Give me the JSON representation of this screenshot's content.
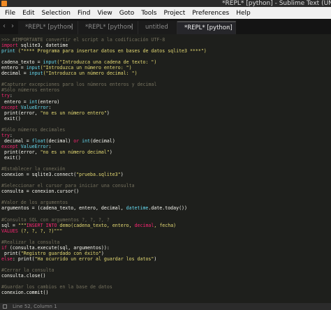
{
  "window": {
    "title": "*REPL* [python] - Sublime Text (UNREG"
  },
  "menu": [
    "File",
    "Edit",
    "Selection",
    "Find",
    "View",
    "Goto",
    "Tools",
    "Project",
    "Preferences",
    "Help"
  ],
  "tabs": [
    {
      "label": "*REPL* [python]",
      "active": false
    },
    {
      "label": "*REPL* [python]",
      "active": false
    },
    {
      "label": "untitled",
      "active": false
    },
    {
      "label": "*REPL* [python]",
      "active": true
    }
  ],
  "code": [
    [
      [
        ">>> ",
        "c"
      ],
      [
        "#IMPORTANTE convertir el script a la codificación UTF-8",
        "c"
      ]
    ],
    [
      [
        "import ",
        "k"
      ],
      [
        "sqlite3, datetime",
        ""
      ]
    ],
    [
      [
        "print ",
        "f"
      ],
      [
        "(\"**** Programa para insertar datos en bases de datos sqlite3 ****\")",
        "s"
      ]
    ],
    [],
    [
      [
        "cadena_texto = ",
        ""
      ],
      [
        "input",
        "f"
      ],
      [
        "(\"Introduzca una cadena de texto: \")",
        "s"
      ]
    ],
    [
      [
        "entero = ",
        ""
      ],
      [
        "input",
        "f"
      ],
      [
        "(\"Introduzca un número entero: \")",
        "s"
      ]
    ],
    [
      [
        "decimal = ",
        ""
      ],
      [
        "input",
        "f"
      ],
      [
        "(\"Introduzca un número decimal: \")",
        "s"
      ]
    ],
    [],
    [
      [
        "#Capturar excepciones para los números enteros y decimal",
        "c"
      ]
    ],
    [
      [
        "#Sólo números enteros",
        "c"
      ]
    ],
    [
      [
        "try",
        "k"
      ],
      [
        ":",
        ""
      ]
    ],
    [
      [
        " entero = ",
        ""
      ],
      [
        "int",
        "f"
      ],
      [
        "(entero)",
        ""
      ]
    ],
    [
      [
        "except ",
        "k"
      ],
      [
        "ValueError",
        "f"
      ],
      [
        ":",
        ""
      ]
    ],
    [
      [
        " print(error, ",
        ""
      ],
      [
        "\"no es un número entero\"",
        "s"
      ],
      [
        ")",
        ""
      ]
    ],
    [
      [
        " exit()",
        ""
      ]
    ],
    [],
    [
      [
        "#Sólo números decimales",
        "c"
      ]
    ],
    [
      [
        "try",
        "k"
      ],
      [
        ":",
        ""
      ]
    ],
    [
      [
        " decimal = ",
        ""
      ],
      [
        "float",
        "f"
      ],
      [
        "(decimal) ",
        ""
      ],
      [
        "or ",
        "k"
      ],
      [
        "int",
        "f"
      ],
      [
        "(decimal)",
        ""
      ]
    ],
    [
      [
        "except ",
        "k"
      ],
      [
        "ValueError",
        "f"
      ],
      [
        ":",
        ""
      ]
    ],
    [
      [
        " print(error, ",
        ""
      ],
      [
        "\"no es un número decimal\"",
        "s"
      ],
      [
        ")",
        ""
      ]
    ],
    [
      [
        " exit()",
        ""
      ]
    ],
    [],
    [
      [
        "#Establecer la conexión",
        "c"
      ]
    ],
    [
      [
        "conexion = sqlite3.connect(",
        ""
      ],
      [
        "\"prueba.sqlite3\"",
        "s"
      ],
      [
        ")",
        ""
      ]
    ],
    [],
    [
      [
        "#Seleccionar el cursor para iniciar una consulta",
        "c"
      ]
    ],
    [
      [
        "consulta = conexion.cursor()",
        ""
      ]
    ],
    [],
    [
      [
        "#Valor de los argumentos",
        "c"
      ]
    ],
    [
      [
        "argumentos = (cadena_texto, entero, decimal, ",
        ""
      ],
      [
        "datetime",
        "f"
      ],
      [
        ".date.today())",
        ""
      ]
    ],
    [],
    [
      [
        "#Consulta SQL con argumentos ?, ?, ?, ?",
        "c"
      ]
    ],
    [
      [
        "sql = ",
        ""
      ],
      [
        "\"\"\"",
        "s"
      ],
      [
        "INSERT INTO ",
        "k"
      ],
      [
        "demo(cadena_texto, entero, ",
        "s"
      ],
      [
        "decimal",
        "k"
      ],
      [
        ", fecha)",
        "s"
      ]
    ],
    [
      [
        "VALUES ",
        "k"
      ],
      [
        "(?, ?, ?, ?)\"\"\"",
        "s"
      ]
    ],
    [],
    [
      [
        "#Realizar la consulta",
        "c"
      ]
    ],
    [
      [
        "if ",
        "k"
      ],
      [
        "(consulta.execute(sql, argumentos)):",
        ""
      ]
    ],
    [
      [
        " print(",
        ""
      ],
      [
        "\"Registro guardado con éxito\"",
        "s"
      ],
      [
        ")",
        ""
      ]
    ],
    [
      [
        "else",
        "k"
      ],
      [
        ": print(",
        ""
      ],
      [
        "\"Ha ocurrido un error al guardar los datos\"",
        "s"
      ],
      [
        ")",
        ""
      ]
    ],
    [],
    [
      [
        "#Cerrar la consulta",
        "c"
      ]
    ],
    [
      [
        "consulta.close()",
        ""
      ]
    ],
    [],
    [
      [
        "#Guardar los cambios en la base de datos",
        "c"
      ]
    ],
    [
      [
        "conexion.commit()",
        ""
      ]
    ]
  ],
  "status": {
    "position": "Line 52, Column 1"
  }
}
